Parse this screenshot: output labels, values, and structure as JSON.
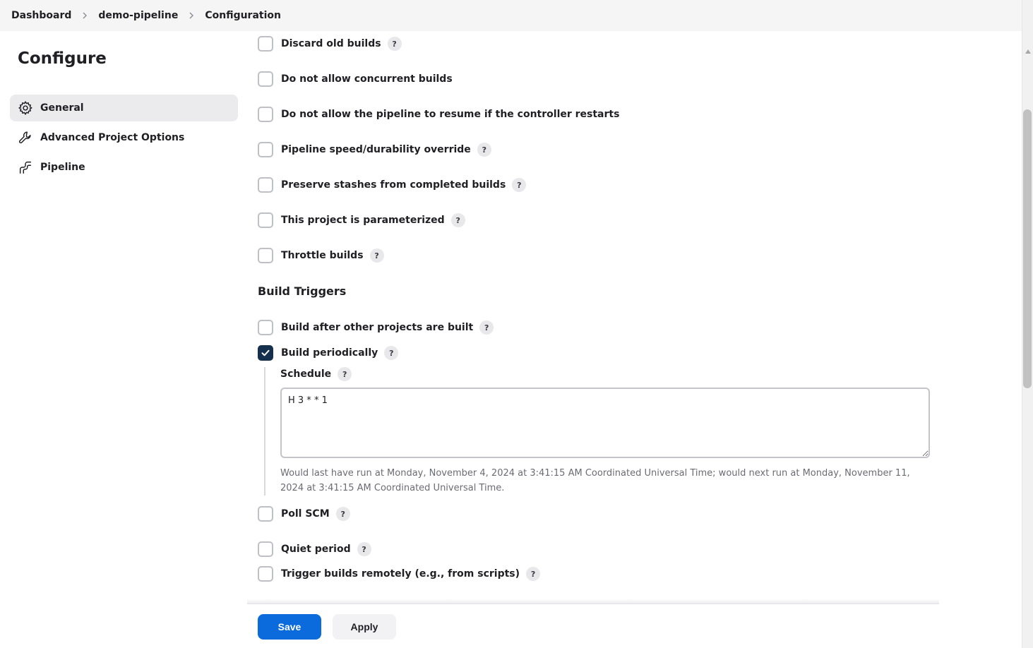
{
  "breadcrumb": [
    "Dashboard",
    "demo-pipeline",
    "Configuration"
  ],
  "sidebar": {
    "title": "Configure",
    "items": [
      {
        "label": "General",
        "icon": "gear-icon",
        "active": true
      },
      {
        "label": "Advanced Project Options",
        "icon": "wrench-icon",
        "active": false
      },
      {
        "label": "Pipeline",
        "icon": "pipeline-icon",
        "active": false
      }
    ]
  },
  "general_options": [
    {
      "label": "Discard old builds",
      "checked": false,
      "help": true
    },
    {
      "label": "Do not allow concurrent builds",
      "checked": false,
      "help": false
    },
    {
      "label": "Do not allow the pipeline to resume if the controller restarts",
      "checked": false,
      "help": false
    },
    {
      "label": "Pipeline speed/durability override",
      "checked": false,
      "help": true
    },
    {
      "label": "Preserve stashes from completed builds",
      "checked": false,
      "help": true
    },
    {
      "label": "This project is parameterized",
      "checked": false,
      "help": true
    },
    {
      "label": "Throttle builds",
      "checked": false,
      "help": true
    }
  ],
  "build_triggers": {
    "title": "Build Triggers",
    "options": [
      {
        "label": "Build after other projects are built",
        "checked": false,
        "help": true
      },
      {
        "label": "Build periodically",
        "checked": true,
        "help": true
      },
      {
        "label": "Poll SCM",
        "checked": false,
        "help": true
      },
      {
        "label": "Quiet period",
        "checked": false,
        "help": true
      },
      {
        "label": "Trigger builds remotely (e.g., from scripts)",
        "checked": false,
        "help": true
      }
    ],
    "schedule": {
      "label": "Schedule",
      "value": "H 3 * * 1",
      "help_text": "Would last have run at Monday, November 4, 2024 at 3:41:15 AM Coordinated Universal Time; would next run at Monday, November 11, 2024 at 3:41:15 AM Coordinated Universal Time."
    }
  },
  "help_glyph": "?",
  "buttons": {
    "save": "Save",
    "apply": "Apply"
  },
  "colors": {
    "primary": "#0b6bdc",
    "checked": "#14304e"
  }
}
